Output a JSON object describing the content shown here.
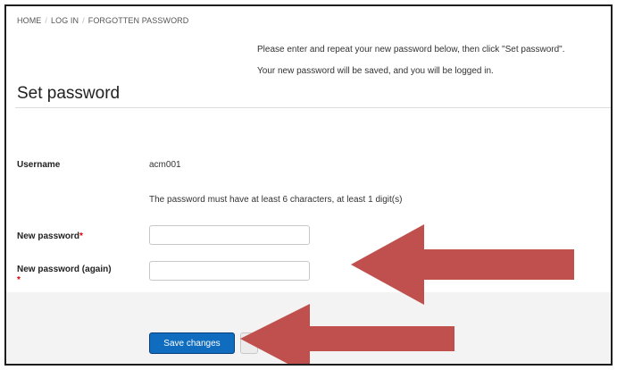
{
  "breadcrumb": [
    "HOME",
    "LOG IN",
    "FORGOTTEN PASSWORD"
  ],
  "instructions": {
    "line1": "Please enter and repeat your new password below, then click \"Set password\".",
    "line2": "Your new password will be saved, and you will be logged in."
  },
  "page_title": "Set password",
  "username": {
    "label": "Username",
    "value": "acm001"
  },
  "password_rule": "The password must have at least 6 characters, at least 1 digit(s)",
  "new_password": {
    "label": "New password",
    "required_marker": "*",
    "value": ""
  },
  "new_password_again": {
    "label": "New password (again)",
    "required_marker": "*",
    "value": ""
  },
  "buttons": {
    "save": "Save changes"
  },
  "colors": {
    "arrow": "#c0504d",
    "primary_button": "#0f6cbf",
    "required": "#dd0000"
  }
}
